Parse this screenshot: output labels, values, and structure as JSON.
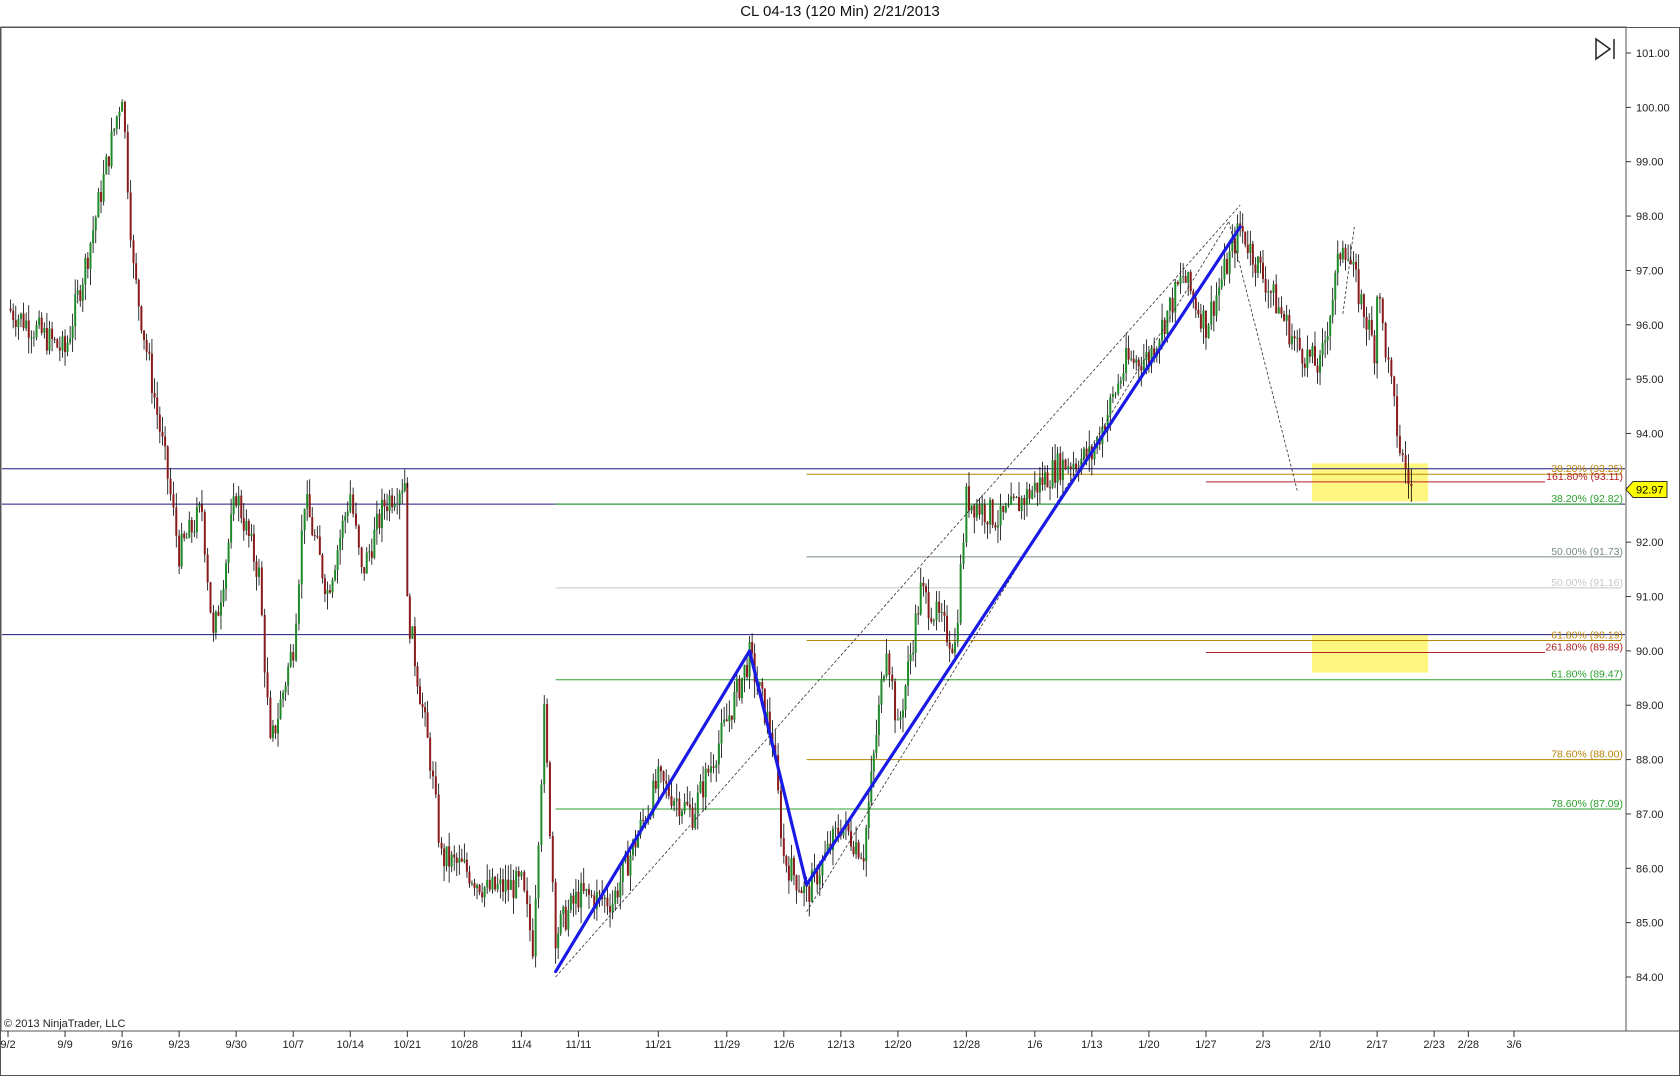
{
  "title": "CL 04-13 (120 Min)  2/21/2013",
  "copyright": "© 2013 NinjaTrader, LLC",
  "last_price_label": "92.97",
  "colors": {
    "candle_up": "#1f8a2a",
    "candle_down": "#8b1a1a",
    "wick": "#000000",
    "fib_orange": "#b8860b",
    "fib_green": "#2ca02c",
    "fib_gray": "#7a8a8a",
    "fib_lightgray": "#c8c8c8",
    "fib_red": "#b22222",
    "support_line": "#1a1a80",
    "pattern_line": "#1a1ae6",
    "highlight": "#fff36b",
    "last_price_bg": "#ffff00"
  },
  "chart_data": {
    "type": "candlestick",
    "title": "CL 04-13 (120 Min)  2/21/2013",
    "xlabel": "",
    "ylabel": "",
    "ylim": [
      83.2,
      101.5
    ],
    "y_ticks": [
      84.0,
      85.0,
      86.0,
      87.0,
      88.0,
      89.0,
      90.0,
      91.0,
      92.0,
      93.0,
      94.0,
      95.0,
      96.0,
      97.0,
      98.0,
      99.0,
      100.0,
      101.0
    ],
    "x_ticks": [
      "9/2",
      "9/9",
      "9/16",
      "9/23",
      "9/30",
      "10/7",
      "10/14",
      "10/21",
      "10/28",
      "11/4",
      "11/11",
      "11/21",
      "11/29",
      "12/6",
      "12/13",
      "12/20",
      "12/28",
      "1/6",
      "1/13",
      "1/20",
      "1/27",
      "2/3",
      "2/10",
      "2/17",
      "2/23",
      "2/28",
      "3/6"
    ],
    "last_price": 92.97,
    "price_path": [
      [
        "9/2",
        96.3
      ],
      [
        "9/9",
        95.5
      ],
      [
        "9/12",
        97.3
      ],
      [
        "9/16",
        100.3
      ],
      [
        "9/18",
        97.0
      ],
      [
        "9/21",
        93.2
      ],
      [
        "9/23",
        91.8
      ],
      [
        "9/26",
        92.6
      ],
      [
        "9/27",
        90.2
      ],
      [
        "9/30",
        92.9
      ],
      [
        "10/3",
        91.4
      ],
      [
        "10/4",
        88.2
      ],
      [
        "10/7",
        90.1
      ],
      [
        "10/9",
        92.8
      ],
      [
        "10/11",
        91.1
      ],
      [
        "10/14",
        92.9
      ],
      [
        "10/16",
        91.4
      ],
      [
        "10/18",
        92.7
      ],
      [
        "10/21",
        93.2
      ],
      [
        "10/22",
        90.8
      ],
      [
        "10/24",
        88.0
      ],
      [
        "10/25",
        86.2
      ],
      [
        "10/28",
        86.0
      ],
      [
        "10/31",
        85.6
      ],
      [
        "11/4",
        85.7
      ],
      [
        "11/6",
        84.6
      ],
      [
        "11/7",
        88.8
      ],
      [
        "11/8",
        84.8
      ],
      [
        "11/11",
        85.5
      ],
      [
        "11/15",
        85.4
      ],
      [
        "11/21",
        87.6
      ],
      [
        "11/26",
        87.0
      ],
      [
        "11/29",
        88.7
      ],
      [
        "12/2",
        89.9
      ],
      [
        "12/5",
        88.4
      ],
      [
        "12/6",
        86.2
      ],
      [
        "12/10",
        85.5
      ],
      [
        "12/13",
        86.8
      ],
      [
        "12/16",
        86.3
      ],
      [
        "12/19",
        90.2
      ],
      [
        "12/20",
        88.5
      ],
      [
        "12/24",
        91.1
      ],
      [
        "12/27",
        90.1
      ],
      [
        "12/28",
        92.8
      ],
      [
        "1/2",
        92.4
      ],
      [
        "1/6",
        93.0
      ],
      [
        "1/9",
        93.4
      ],
      [
        "1/13",
        93.6
      ],
      [
        "1/17",
        95.3
      ],
      [
        "1/20",
        95.4
      ],
      [
        "1/24",
        96.9
      ],
      [
        "1/27",
        96.0
      ],
      [
        "1/31",
        97.8
      ],
      [
        "2/3",
        96.9
      ],
      [
        "2/7",
        95.6
      ],
      [
        "2/10",
        95.2
      ],
      [
        "2/13",
        97.6
      ],
      [
        "2/17",
        95.4
      ],
      [
        "2/18",
        96.7
      ],
      [
        "2/19",
        95.2
      ],
      [
        "2/20",
        93.7
      ],
      [
        "2/21",
        92.97
      ]
    ],
    "horizontal_levels": [
      {
        "price": 93.35,
        "kind": "support"
      },
      {
        "price": 92.7,
        "kind": "support"
      },
      {
        "price": 90.3,
        "kind": "support"
      }
    ],
    "fib_levels": [
      {
        "label": "38.20% (93.25)",
        "price": 93.25,
        "color": "fib_orange",
        "x_start": "12/10"
      },
      {
        "label": "161.80% (93.11)",
        "price": 93.11,
        "color": "fib_red",
        "x_start": "1/27"
      },
      {
        "label": "38.20% (92.82)",
        "price": 92.7,
        "color": "fib_green",
        "x_start": "11/8"
      },
      {
        "label": "50.00% (91.73)",
        "price": 91.73,
        "color": "fib_gray",
        "x_start": "12/10"
      },
      {
        "label": "50.00% (91.16)",
        "price": 91.16,
        "color": "fib_lightgray",
        "x_start": "11/8"
      },
      {
        "label": "61.80% (90.19)",
        "price": 90.19,
        "color": "fib_orange",
        "x_start": "12/10"
      },
      {
        "label": "261.80% (89.89)",
        "price": 89.97,
        "color": "fib_red",
        "x_start": "1/27"
      },
      {
        "label": "61.80% (89.47)",
        "price": 89.47,
        "color": "fib_green",
        "x_start": "11/8"
      },
      {
        "label": "78.60% (88.00)",
        "price": 88.0,
        "color": "fib_orange",
        "x_start": "12/10"
      },
      {
        "label": "78.60% (87.09)",
        "price": 87.09,
        "color": "fib_green",
        "x_start": "11/8"
      }
    ],
    "highlight_zones": [
      {
        "x_start": "2/10",
        "x_end": "2/23",
        "y_low": 92.75,
        "y_high": 93.45
      },
      {
        "x_start": "2/10",
        "x_end": "2/23",
        "y_low": 89.6,
        "y_high": 90.3
      }
    ],
    "pattern_lines": [
      {
        "from": [
          "11/8",
          84.1
        ],
        "to": [
          "12/2",
          90.0
        ]
      },
      {
        "from": [
          "12/2",
          90.0
        ],
        "to": [
          "12/10",
          85.7
        ]
      },
      {
        "from": [
          "12/10",
          85.7
        ],
        "to": [
          "1/31",
          97.8
        ]
      }
    ],
    "dashed_lines": [
      {
        "from": [
          "11/8",
          84.0
        ],
        "to": [
          "1/31",
          98.2
        ]
      },
      {
        "from": [
          "12/10",
          85.2
        ],
        "to": [
          "1/30",
          97.9
        ]
      },
      {
        "from": [
          "1/30",
          97.9
        ],
        "to": [
          "2/7",
          92.95
        ]
      },
      {
        "from": [
          "2/13",
          96.2
        ],
        "to": [
          "2/14",
          97.8
        ]
      }
    ]
  }
}
